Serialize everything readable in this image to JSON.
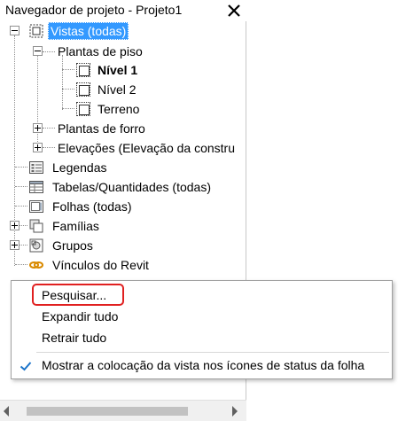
{
  "window": {
    "title": "Navegador de projeto - Projeto1",
    "close_glyph": "✕"
  },
  "tree": {
    "views": {
      "label": "Vistas (todas)",
      "icon": "views-icon"
    },
    "floor_plans": {
      "label": "Plantas de piso"
    },
    "level1": {
      "label": "Nível 1"
    },
    "level2": {
      "label": "Nível 2"
    },
    "terrain": {
      "label": "Terreno"
    },
    "ceiling_plans": {
      "label": "Plantas de forro"
    },
    "elevations": {
      "label": "Elevações (Elevação da constru"
    },
    "legends": {
      "label": "Legendas",
      "icon": "legend-icon"
    },
    "schedules": {
      "label": "Tabelas/Quantidades (todas)",
      "icon": "schedule-icon"
    },
    "sheets": {
      "label": "Folhas (todas)",
      "icon": "sheet-icon"
    },
    "families": {
      "label": "Famílias",
      "icon": "family-icon"
    },
    "groups": {
      "label": "Grupos",
      "icon": "group-icon"
    },
    "links": {
      "label": "Vínculos do Revit",
      "icon": "link-icon"
    }
  },
  "context_menu": {
    "search": "Pesquisar...",
    "expand_all": "Expandir tudo",
    "collapse_all": "Retrair tudo",
    "show_placement": "Mostrar a colocação da vista nos ícones de status da folha"
  },
  "colors": {
    "selection": "#3399ff",
    "highlight_border": "#e02020",
    "check": "#1a73c9"
  }
}
